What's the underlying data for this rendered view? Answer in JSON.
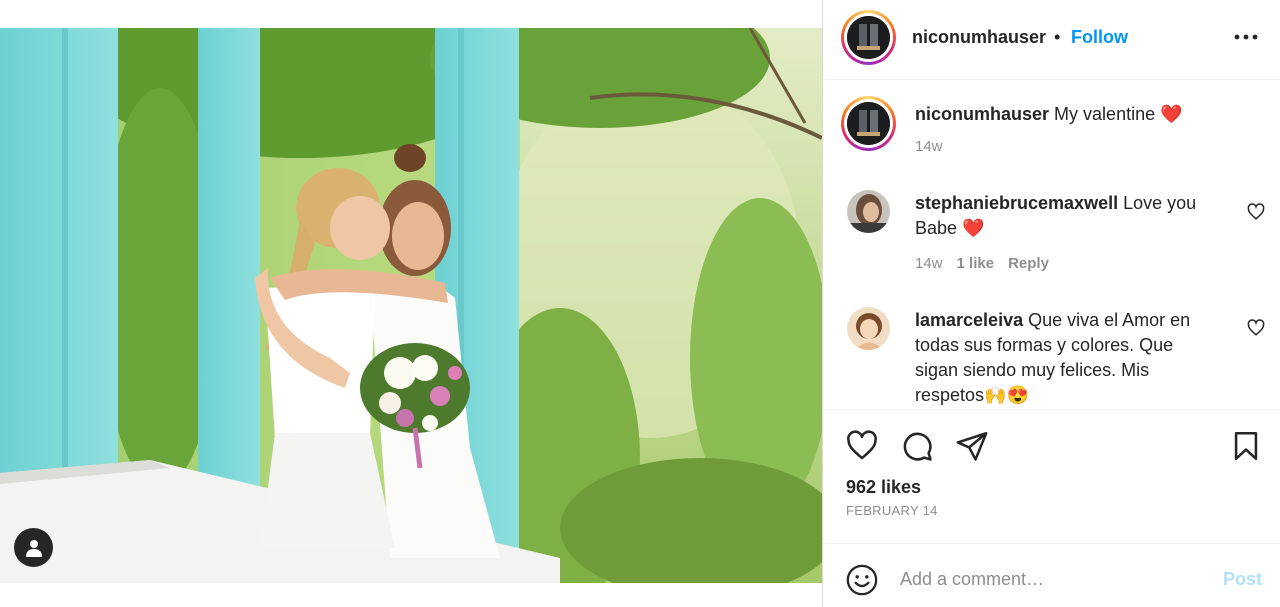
{
  "post": {
    "username": "niconumhauser",
    "separator": "•",
    "follow_label": "Follow",
    "more_icon": "more-options-icon",
    "caption": {
      "username": "niconumhauser",
      "text": "My valentine",
      "emoji": "❤️",
      "age": "14w"
    },
    "comments": [
      {
        "username": "stephaniebrucemaxwell",
        "text": "Love you Babe",
        "emoji": "❤️",
        "age": "14w",
        "likes": "1 like",
        "reply_label": "Reply"
      },
      {
        "username": "lamarceleiva",
        "text": "Que viva el Amor en todas sus formas y colores. Que sigan siendo muy felices. Mis respetos",
        "emoji": "🙌😍"
      }
    ],
    "likes_label": "962 likes",
    "date_label": "FEBRUARY 14",
    "add_comment": {
      "placeholder": "Add a comment…",
      "post_label": "Post"
    }
  },
  "colors": {
    "link_blue": "#0095f6",
    "post_disabled": "#b2dffc",
    "heart_red": "#ed4956",
    "muted": "#8e8e8e"
  }
}
